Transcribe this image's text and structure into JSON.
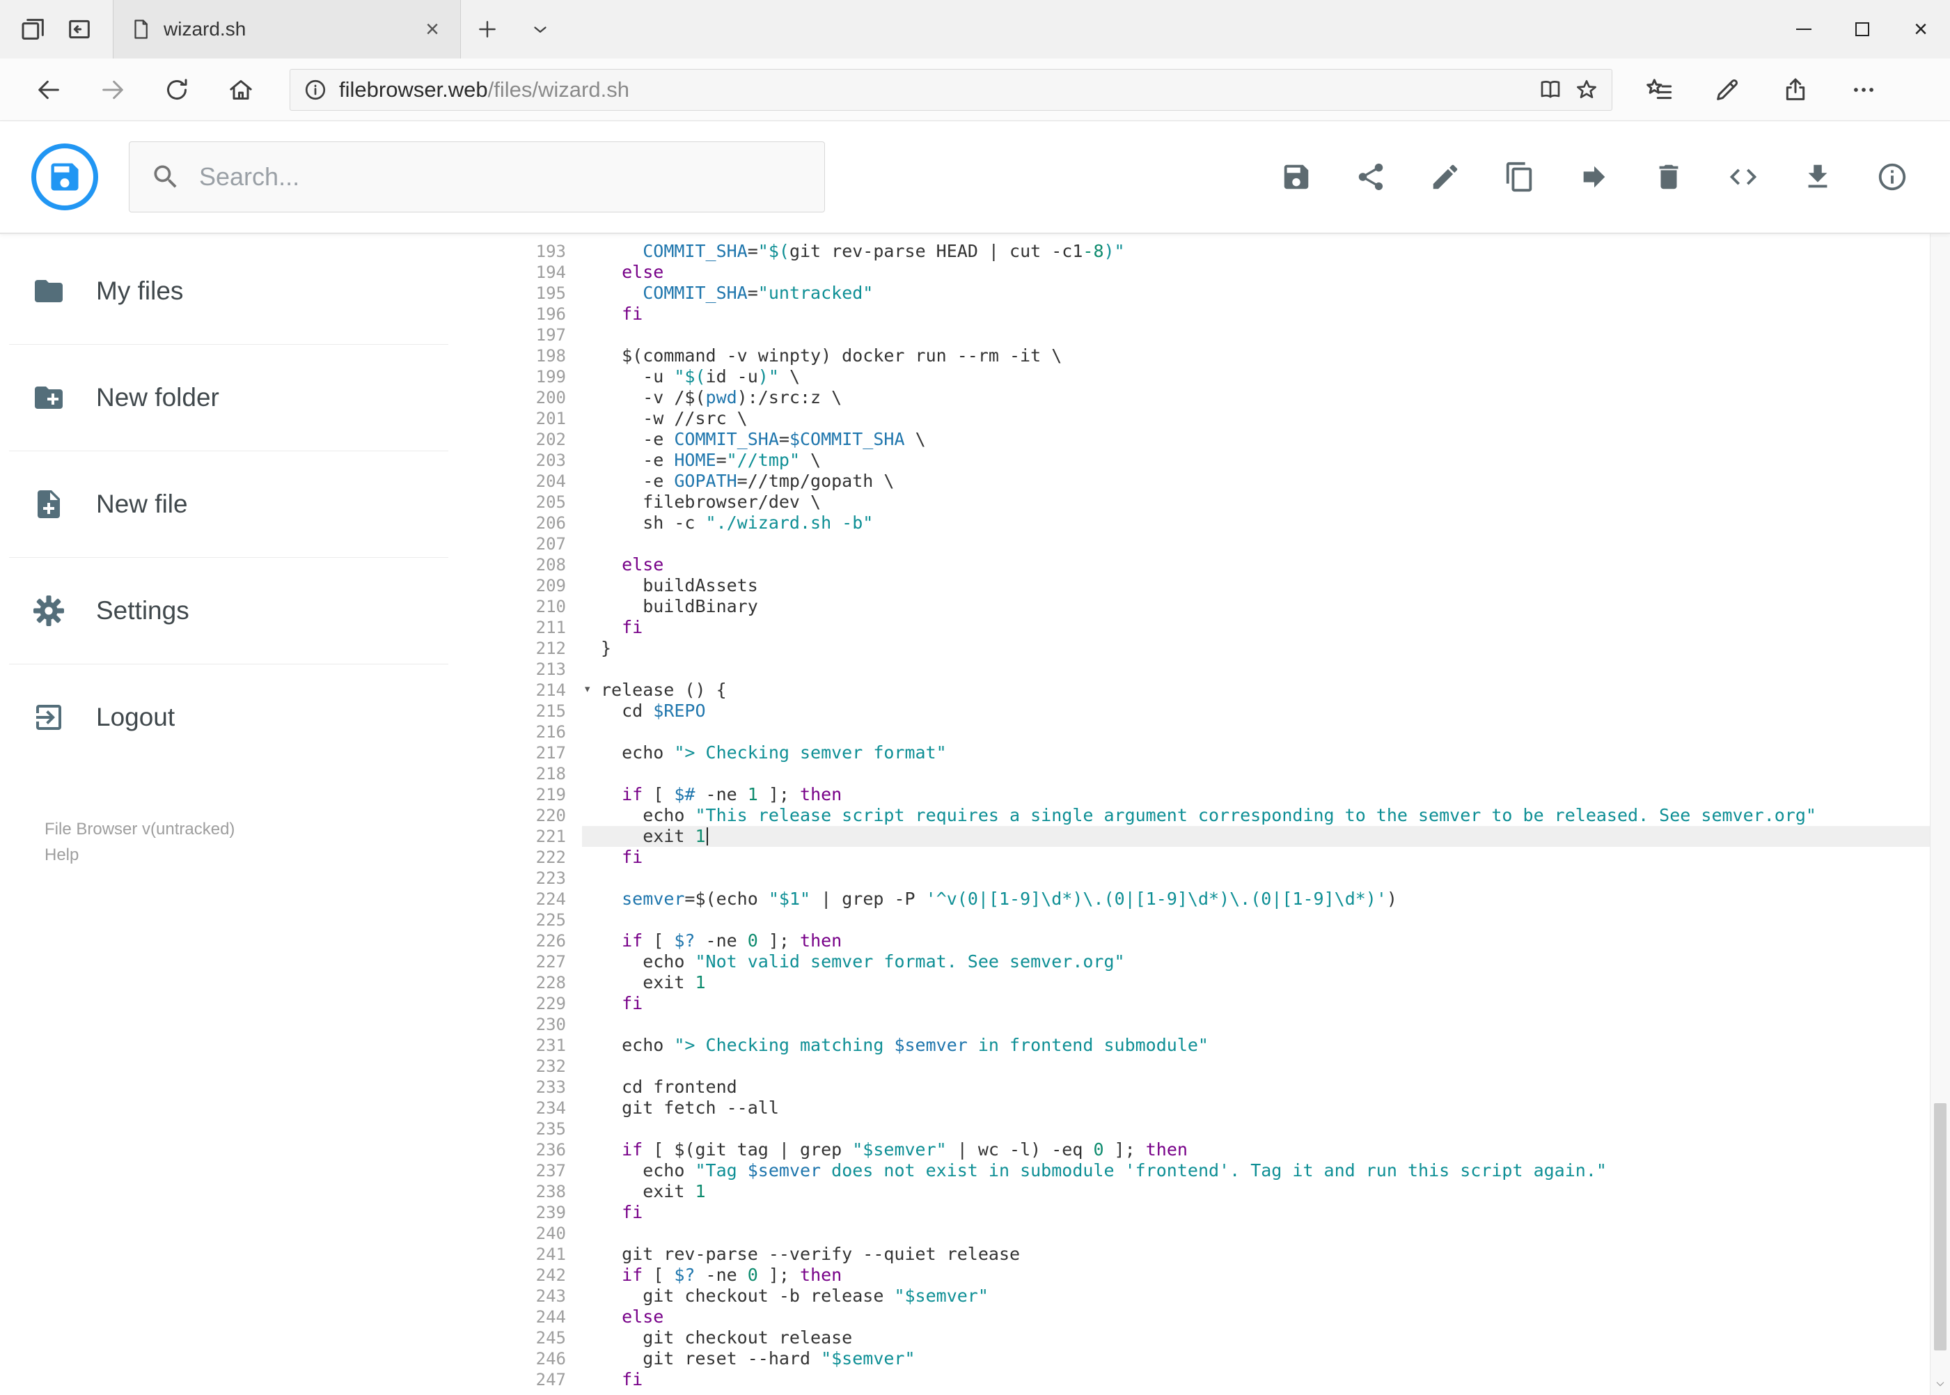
{
  "browser": {
    "tab_title": "wizard.sh",
    "url_host": "filebrowser.web",
    "url_path": "/files/wizard.sh"
  },
  "header": {
    "search_placeholder": "Search...",
    "action_icons": [
      "save-icon",
      "share-icon",
      "edit-icon",
      "copy-icon",
      "move-icon",
      "delete-icon",
      "code-icon",
      "download-icon",
      "info-icon"
    ],
    "accent_color": "#2196f3"
  },
  "sidebar": {
    "items": [
      {
        "label": "My files",
        "icon": "folder-icon"
      },
      {
        "label": "New folder",
        "icon": "new-folder-icon"
      },
      {
        "label": "New file",
        "icon": "new-file-icon"
      },
      {
        "label": "Settings",
        "icon": "settings-gear-icon"
      },
      {
        "label": "Logout",
        "icon": "logout-icon"
      }
    ],
    "footer_version": "File Browser v(untracked)",
    "footer_help": "Help"
  },
  "editor": {
    "language": "shell",
    "active_line": 221,
    "lines": [
      {
        "n": 193,
        "t": [
          [
            "p",
            "    "
          ],
          [
            "v",
            "COMMIT_SHA"
          ],
          [
            "p",
            "="
          ],
          [
            "s",
            "\"$("
          ],
          [
            "p",
            "git rev-parse HEAD | cut -c1"
          ],
          [
            "n",
            "-8"
          ],
          [
            "s",
            ")\""
          ]
        ]
      },
      {
        "n": 194,
        "t": [
          [
            "p",
            "  "
          ],
          [
            "k",
            "else"
          ]
        ]
      },
      {
        "n": 195,
        "t": [
          [
            "p",
            "    "
          ],
          [
            "v",
            "COMMIT_SHA"
          ],
          [
            "p",
            "="
          ],
          [
            "s",
            "\"untracked\""
          ]
        ]
      },
      {
        "n": 196,
        "t": [
          [
            "p",
            "  "
          ],
          [
            "k",
            "fi"
          ]
        ]
      },
      {
        "n": 197,
        "t": []
      },
      {
        "n": 198,
        "t": [
          [
            "p",
            "  $(command -v winpty) docker run --rm -it \\"
          ]
        ]
      },
      {
        "n": 199,
        "t": [
          [
            "p",
            "    -u "
          ],
          [
            "s",
            "\"$("
          ],
          [
            "p",
            "id -u"
          ],
          [
            "s",
            ")\""
          ],
          [
            "p",
            " \\"
          ]
        ]
      },
      {
        "n": 200,
        "t": [
          [
            "p",
            "    -v /$("
          ],
          [
            "v",
            "pwd"
          ],
          [
            "p",
            "):/src:z \\"
          ]
        ]
      },
      {
        "n": 201,
        "t": [
          [
            "p",
            "    -w //src \\"
          ]
        ]
      },
      {
        "n": 202,
        "t": [
          [
            "p",
            "    -e "
          ],
          [
            "v",
            "COMMIT_SHA"
          ],
          [
            "p",
            "="
          ],
          [
            "v",
            "$COMMIT_SHA"
          ],
          [
            "p",
            " \\"
          ]
        ]
      },
      {
        "n": 203,
        "t": [
          [
            "p",
            "    -e "
          ],
          [
            "v",
            "HOME"
          ],
          [
            "p",
            "="
          ],
          [
            "s",
            "\"//tmp\""
          ],
          [
            "p",
            " \\"
          ]
        ]
      },
      {
        "n": 204,
        "t": [
          [
            "p",
            "    -e "
          ],
          [
            "v",
            "GOPATH"
          ],
          [
            "p",
            "=//tmp/gopath \\"
          ]
        ]
      },
      {
        "n": 205,
        "t": [
          [
            "p",
            "    filebrowser/dev \\"
          ]
        ]
      },
      {
        "n": 206,
        "t": [
          [
            "p",
            "    sh -c "
          ],
          [
            "s",
            "\"./wizard.sh -b\""
          ]
        ]
      },
      {
        "n": 207,
        "t": []
      },
      {
        "n": 208,
        "t": [
          [
            "p",
            "  "
          ],
          [
            "k",
            "else"
          ]
        ]
      },
      {
        "n": 209,
        "t": [
          [
            "p",
            "    buildAssets"
          ]
        ]
      },
      {
        "n": 210,
        "t": [
          [
            "p",
            "    buildBinary"
          ]
        ]
      },
      {
        "n": 211,
        "t": [
          [
            "p",
            "  "
          ],
          [
            "k",
            "fi"
          ]
        ]
      },
      {
        "n": 212,
        "t": [
          [
            "p",
            "}"
          ]
        ]
      },
      {
        "n": 213,
        "t": []
      },
      {
        "n": 214,
        "fold": true,
        "t": [
          [
            "p",
            "release () {"
          ]
        ]
      },
      {
        "n": 215,
        "t": [
          [
            "p",
            "  cd "
          ],
          [
            "v",
            "$REPO"
          ]
        ]
      },
      {
        "n": 216,
        "t": []
      },
      {
        "n": 217,
        "t": [
          [
            "p",
            "  echo "
          ],
          [
            "s",
            "\"> Checking semver format\""
          ]
        ]
      },
      {
        "n": 218,
        "t": []
      },
      {
        "n": 219,
        "t": [
          [
            "p",
            "  "
          ],
          [
            "k",
            "if"
          ],
          [
            "p",
            " [ "
          ],
          [
            "v",
            "$#"
          ],
          [
            "p",
            " -ne "
          ],
          [
            "n",
            "1"
          ],
          [
            "p",
            " ]; "
          ],
          [
            "k",
            "then"
          ]
        ]
      },
      {
        "n": 220,
        "t": [
          [
            "p",
            "    echo "
          ],
          [
            "s",
            "\"This release script requires a single argument corresponding to the semver to be released. See semver.org\""
          ]
        ]
      },
      {
        "n": 221,
        "active": true,
        "cursor": true,
        "t": [
          [
            "p",
            "    exit "
          ],
          [
            "n",
            "1"
          ]
        ]
      },
      {
        "n": 222,
        "t": [
          [
            "p",
            "  "
          ],
          [
            "k",
            "fi"
          ]
        ]
      },
      {
        "n": 223,
        "t": []
      },
      {
        "n": 224,
        "t": [
          [
            "p",
            "  "
          ],
          [
            "v",
            "semver"
          ],
          [
            "p",
            "=$(echo "
          ],
          [
            "s",
            "\"$1\""
          ],
          [
            "p",
            " | grep -P "
          ],
          [
            "s",
            "'^v(0|[1-9]\\d*)\\.(0|[1-9]\\d*)\\.(0|[1-9]\\d*)'"
          ],
          [
            "p",
            ")"
          ]
        ]
      },
      {
        "n": 225,
        "t": []
      },
      {
        "n": 226,
        "t": [
          [
            "p",
            "  "
          ],
          [
            "k",
            "if"
          ],
          [
            "p",
            " [ "
          ],
          [
            "v",
            "$?"
          ],
          [
            "p",
            " -ne "
          ],
          [
            "n",
            "0"
          ],
          [
            "p",
            " ]; "
          ],
          [
            "k",
            "then"
          ]
        ]
      },
      {
        "n": 227,
        "t": [
          [
            "p",
            "    echo "
          ],
          [
            "s",
            "\"Not valid semver format. See semver.org\""
          ]
        ]
      },
      {
        "n": 228,
        "t": [
          [
            "p",
            "    exit "
          ],
          [
            "n",
            "1"
          ]
        ]
      },
      {
        "n": 229,
        "t": [
          [
            "p",
            "  "
          ],
          [
            "k",
            "fi"
          ]
        ]
      },
      {
        "n": 230,
        "t": []
      },
      {
        "n": 231,
        "t": [
          [
            "p",
            "  echo "
          ],
          [
            "s",
            "\"> Checking matching "
          ],
          [
            "v",
            "$semver"
          ],
          [
            "s",
            " in frontend submodule\""
          ]
        ]
      },
      {
        "n": 232,
        "t": []
      },
      {
        "n": 233,
        "t": [
          [
            "p",
            "  cd frontend"
          ]
        ]
      },
      {
        "n": 234,
        "t": [
          [
            "p",
            "  git fetch --all"
          ]
        ]
      },
      {
        "n": 235,
        "t": []
      },
      {
        "n": 236,
        "t": [
          [
            "p",
            "  "
          ],
          [
            "k",
            "if"
          ],
          [
            "p",
            " [ $(git tag | grep "
          ],
          [
            "s",
            "\"$semver\""
          ],
          [
            "p",
            " | wc -l) -eq "
          ],
          [
            "n",
            "0"
          ],
          [
            "p",
            " ]; "
          ],
          [
            "k",
            "then"
          ]
        ]
      },
      {
        "n": 237,
        "t": [
          [
            "p",
            "    echo "
          ],
          [
            "s",
            "\"Tag "
          ],
          [
            "v",
            "$semver"
          ],
          [
            "s",
            " does not exist in submodule 'frontend'. Tag it and run this script again.\""
          ]
        ]
      },
      {
        "n": 238,
        "t": [
          [
            "p",
            "    exit "
          ],
          [
            "n",
            "1"
          ]
        ]
      },
      {
        "n": 239,
        "t": [
          [
            "p",
            "  "
          ],
          [
            "k",
            "fi"
          ]
        ]
      },
      {
        "n": 240,
        "t": []
      },
      {
        "n": 241,
        "t": [
          [
            "p",
            "  git rev-parse --verify --quiet release"
          ]
        ]
      },
      {
        "n": 242,
        "t": [
          [
            "p",
            "  "
          ],
          [
            "k",
            "if"
          ],
          [
            "p",
            " [ "
          ],
          [
            "v",
            "$?"
          ],
          [
            "p",
            " -ne "
          ],
          [
            "n",
            "0"
          ],
          [
            "p",
            " ]; "
          ],
          [
            "k",
            "then"
          ]
        ]
      },
      {
        "n": 243,
        "t": [
          [
            "p",
            "    git checkout -b release "
          ],
          [
            "s",
            "\"$semver\""
          ]
        ]
      },
      {
        "n": 244,
        "t": [
          [
            "p",
            "  "
          ],
          [
            "k",
            "else"
          ]
        ]
      },
      {
        "n": 245,
        "t": [
          [
            "p",
            "    git checkout release"
          ]
        ]
      },
      {
        "n": 246,
        "t": [
          [
            "p",
            "    git reset --hard "
          ],
          [
            "s",
            "\"$semver\""
          ]
        ]
      },
      {
        "n": 247,
        "t": [
          [
            "p",
            "  "
          ],
          [
            "k",
            "fi"
          ]
        ]
      }
    ]
  }
}
